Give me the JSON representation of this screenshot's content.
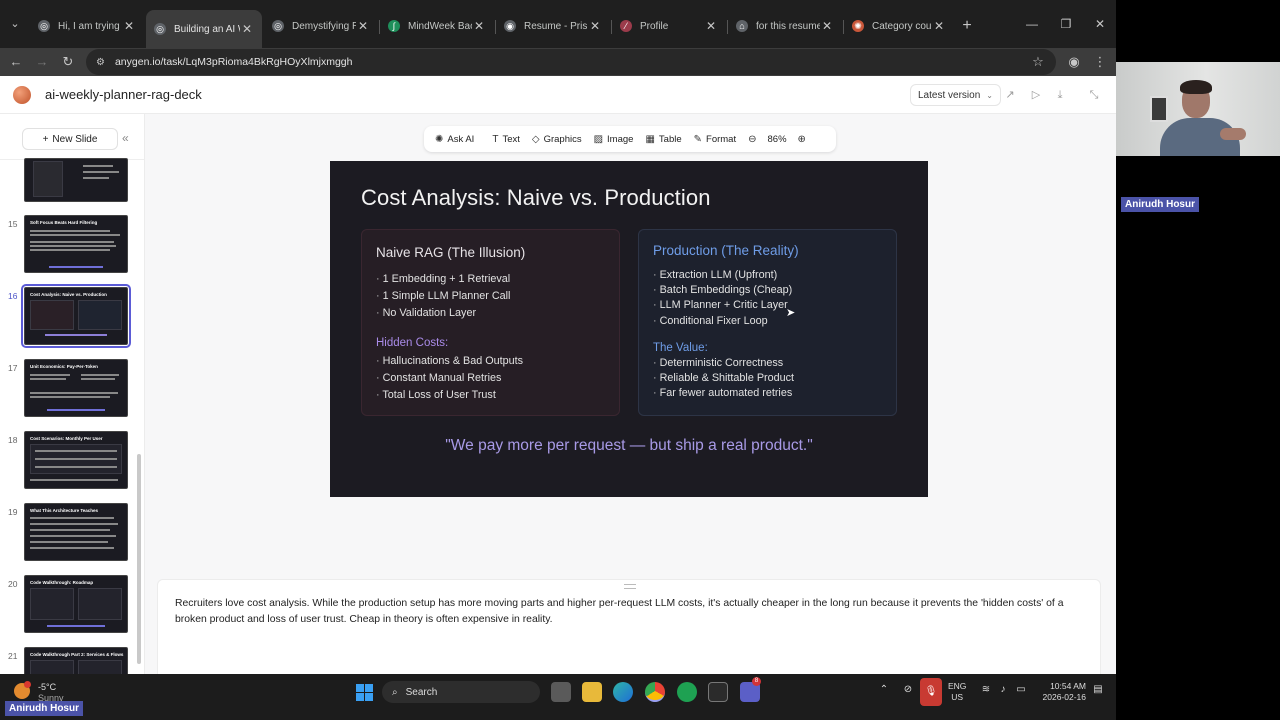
{
  "browser": {
    "tabs": [
      {
        "title": "Hi, I am trying to",
        "color": "#5f6368",
        "glyph": "◎"
      },
      {
        "title": "Building an AI W",
        "color": "#5f6368",
        "glyph": "◎",
        "active": true
      },
      {
        "title": "Demystifying RA",
        "color": "#5f6368",
        "glyph": "◎"
      },
      {
        "title": "MindWeek Back",
        "color": "#1f8f5b",
        "glyph": "∫"
      },
      {
        "title": "Resume - Prism",
        "color": "#5f6368",
        "glyph": "◉"
      },
      {
        "title": "Profile",
        "color": "#9b3b4b",
        "glyph": "⁄"
      },
      {
        "title": "for this resume",
        "color": "#5f6368",
        "glyph": "⌂"
      },
      {
        "title": "Category count",
        "color": "#c9573a",
        "glyph": "✺"
      }
    ],
    "url": "anygen.io/task/LqM3pRioma4BkRgHOyXlmjxmggh"
  },
  "app": {
    "title": "ai-weekly-planner-rag-deck",
    "version_label": "Latest version"
  },
  "sidebar": {
    "new_slide_label": "New Slide",
    "slides": [
      {
        "num": "",
        "title": ""
      },
      {
        "num": "15",
        "title": "Soft Focus Beats Hard Filtering"
      },
      {
        "num": "16",
        "title": "Cost Analysis: Naive vs. Production",
        "active": true
      },
      {
        "num": "17",
        "title": "Unit Economics: Pay-Per-Token"
      },
      {
        "num": "18",
        "title": "Cost Scenarios: Monthly Per User"
      },
      {
        "num": "19",
        "title": "What This Architecture Teaches"
      },
      {
        "num": "20",
        "title": "Code Walkthrough: Roadmap"
      },
      {
        "num": "21",
        "title": "Code Walkthrough Part 2: Services & Flows"
      }
    ]
  },
  "toolbar": {
    "ask_ai": "Ask AI",
    "text": "Text",
    "graphics": "Graphics",
    "image": "Image",
    "table": "Table",
    "format": "Format",
    "zoom": "86%"
  },
  "slide": {
    "title": "Cost Analysis: Naive vs. Production",
    "naive": {
      "heading": "Naive RAG (The Illusion)",
      "items": [
        "1 Embedding + 1 Retrieval",
        "1 Simple LLM Planner Call",
        "No Validation Layer"
      ],
      "sub_heading": "Hidden Costs:",
      "sub_items": [
        "Hallucinations & Bad Outputs",
        "Constant Manual Retries",
        "Total Loss of User Trust"
      ]
    },
    "production": {
      "heading": "Production (The Reality)",
      "items": [
        "Extraction LLM (Upfront)",
        "Batch Embeddings (Cheap)",
        "LLM Planner + Critic Layer",
        "Conditional Fixer Loop"
      ],
      "sub_heading": "The Value:",
      "sub_items": [
        "Deterministic Correctness",
        "Reliable & Shittable Product",
        "Far fewer automated retries"
      ]
    },
    "quote": "\"We pay more per request — but ship a real product.\""
  },
  "notes": {
    "text": "Recruiters love cost analysis. While the production setup has more moving parts and higher per-request LLM costs, it's actually cheaper in the long run because it prevents the 'hidden costs' of a broken product and loss of user trust. Cheap in theory is often expensive in reality."
  },
  "webcam": {
    "name": "Anirudh Hosur"
  },
  "taskbar": {
    "temp": "-5°C",
    "condition": "Sunny",
    "search_label": "Search",
    "lang_top": "ENG",
    "lang_bottom": "US",
    "time": "10:54 AM",
    "date": "2026-02-16",
    "badge": "8"
  }
}
